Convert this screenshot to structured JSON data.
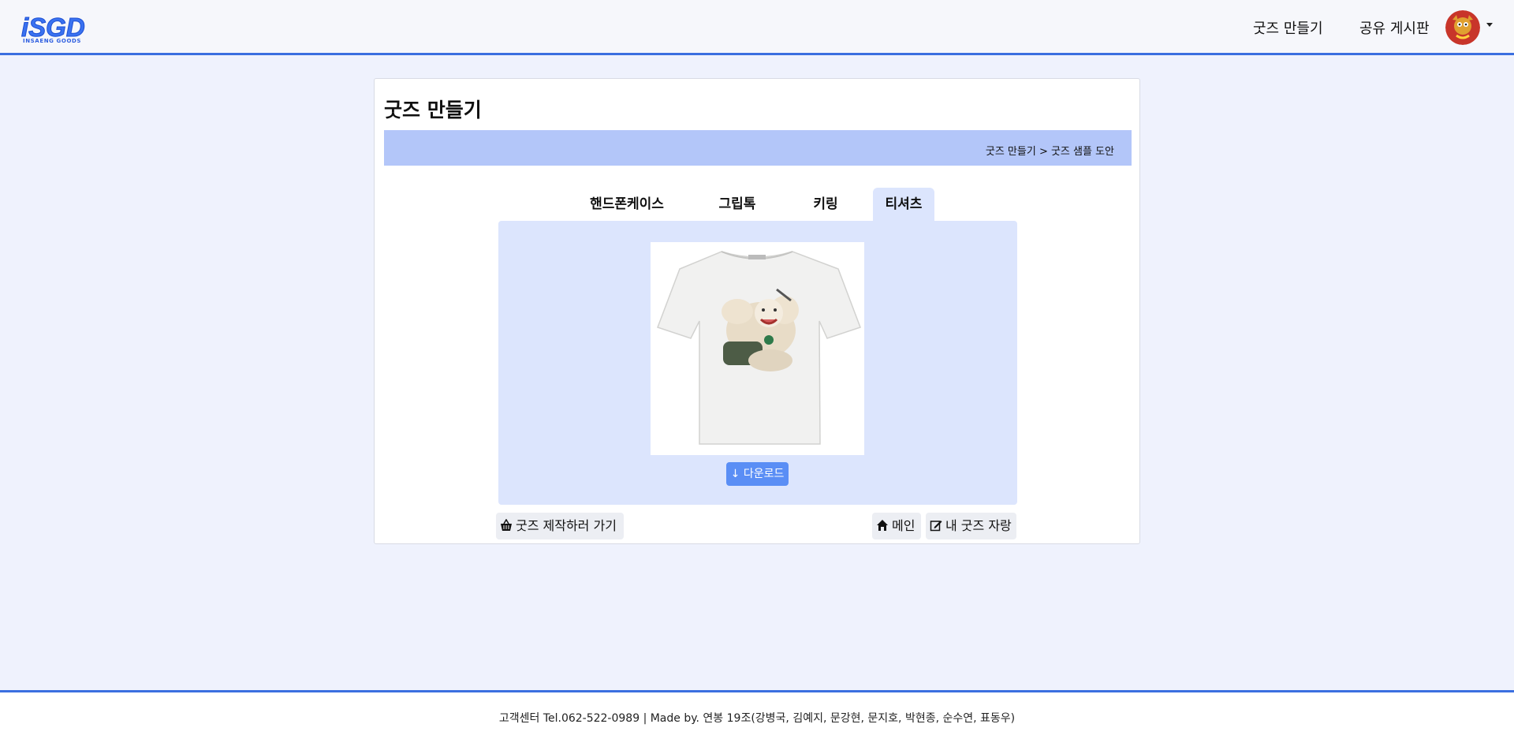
{
  "header": {
    "logo_text": "iSGD",
    "logo_sub": "INSAENG GOODS",
    "nav": [
      {
        "label": "굿즈 만들기"
      },
      {
        "label": "공유 게시판"
      }
    ]
  },
  "main": {
    "title": "굿즈 만들기",
    "breadcrumb": "굿즈 만들기 > 굿즈 샘플 도안",
    "tabs": [
      {
        "label": "핸드폰케이스"
      },
      {
        "label": "그립톡"
      },
      {
        "label": "키링"
      },
      {
        "label": "티셔츠",
        "active": true
      }
    ],
    "download_label": "↓ 다운로드",
    "buttons": {
      "make": "굿즈 제작하러 가기",
      "main": "메인",
      "brag": "내 굿즈 자랑"
    }
  },
  "footer": {
    "text": "고객센터 Tel.062-522-0989 | Made by. 연봉 19조(강병국, 김예지, 문강현, 문지호, 박현종, 순수연, 표동우)"
  },
  "colors": {
    "accent": "#3b6fe0",
    "background": "#eff2fd",
    "breadcrumb_bar": "#b3c6f9",
    "panel": "#dce5fd",
    "download_button": "#5a8ef5"
  },
  "icons": [
    "avatar-character",
    "caret-down-icon",
    "basket-icon",
    "house-icon",
    "edit-icon"
  ]
}
